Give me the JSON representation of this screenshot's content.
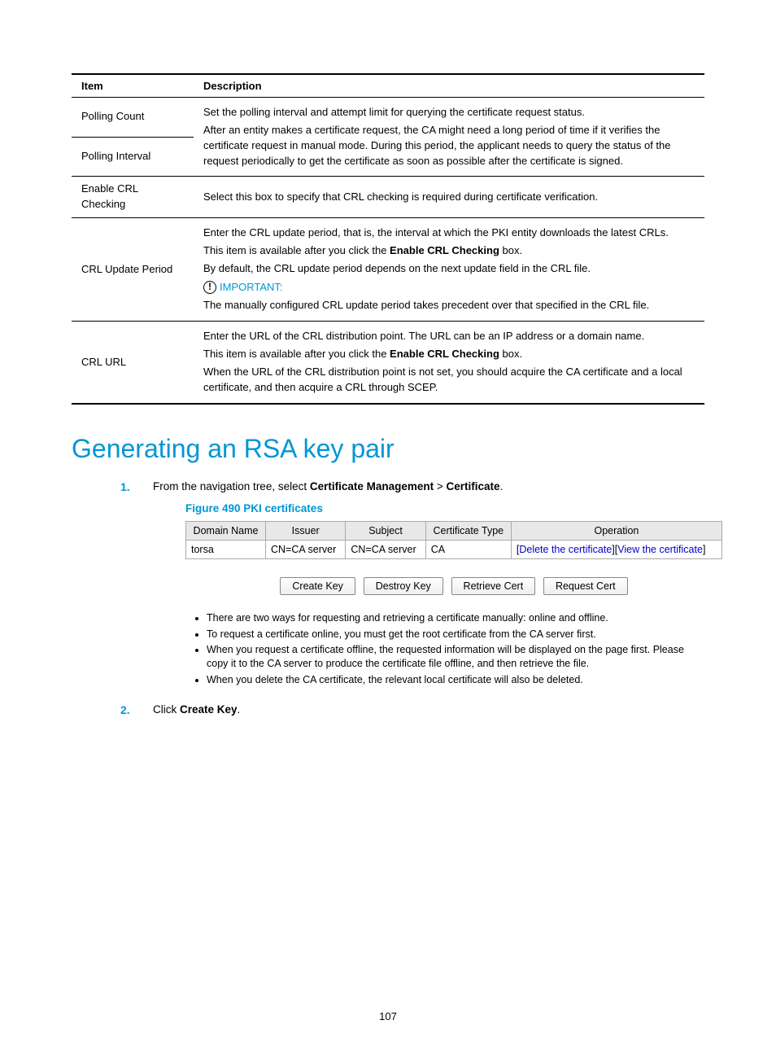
{
  "config_table": {
    "headers": {
      "item": "Item",
      "desc": "Description"
    },
    "rows": [
      {
        "item": "Polling Count",
        "desc_rowspan": true,
        "desc_paras": [
          "Set the polling interval and attempt limit for querying the certificate request status.",
          "After an entity makes a certificate request, the CA might need a long period of time if it verifies the certificate request in manual mode. During this period, the applicant needs to query the status of the request periodically to get the certificate as soon as possible after the certificate is signed."
        ]
      },
      {
        "item": "Polling Interval"
      },
      {
        "item": "Enable CRL Checking",
        "desc_paras": [
          "Select this box to specify that CRL checking is required during certificate verification."
        ]
      },
      {
        "item": "CRL Update Period",
        "important_label": "IMPORTANT:",
        "desc_paras": [
          "Enter the CRL update period, that is, the interval at which the PKI entity downloads the latest CRLs.",
          {
            "prefix": "This item is available after you click the ",
            "bold": "Enable CRL Checking",
            "suffix": " box."
          },
          "By default, the CRL update period depends on the next update field in the CRL file.",
          "__IMPORTANT__",
          "The manually configured CRL update period takes precedent over that specified in the CRL file."
        ]
      },
      {
        "item": "CRL URL",
        "desc_paras": [
          "Enter the URL of the CRL distribution point. The URL can be an IP address or a domain name.",
          {
            "prefix": "This item is available after you click the ",
            "bold": "Enable CRL Checking",
            "suffix": " box."
          },
          "When the URL of the CRL distribution point is not set, you should acquire the CA certificate and a local certificate, and then acquire a CRL through SCEP."
        ]
      }
    ]
  },
  "heading": "Generating an RSA key pair",
  "steps": {
    "step1": {
      "prefix": "From the navigation tree, select ",
      "bold1": "Certificate Management",
      "sep": " > ",
      "bold2": "Certificate",
      "suffix": "."
    },
    "step2": {
      "prefix": "Click ",
      "bold1": "Create Key",
      "suffix": "."
    }
  },
  "figure_caption": "Figure 490 PKI certificates",
  "ui": {
    "headers": {
      "domain": "Domain Name",
      "issuer": "Issuer",
      "subject": "Subject",
      "cert_type": "Certificate Type",
      "operation": "Operation"
    },
    "row": {
      "domain": "torsa",
      "issuer": "CN=CA server",
      "subject": "CN=CA server",
      "cert_type": "CA",
      "op_delete": "Delete the certificate",
      "op_view": "View the certificate"
    },
    "buttons": {
      "create": "Create Key",
      "destroy": "Destroy Key",
      "retrieve": "Retrieve Cert",
      "request": "Request Cert"
    },
    "notes": [
      "There are two ways for requesting and retrieving a certificate manually: online and offline.",
      "To request a certificate online, you must get the root certificate from the CA server first.",
      "When you request a certificate offline, the requested information will be displayed on the page first. Please copy it to the CA server to produce the certificate file offline, and then retrieve the file.",
      "When you delete the CA certificate, the relevant local certificate will also be deleted."
    ]
  },
  "page_number": "107"
}
